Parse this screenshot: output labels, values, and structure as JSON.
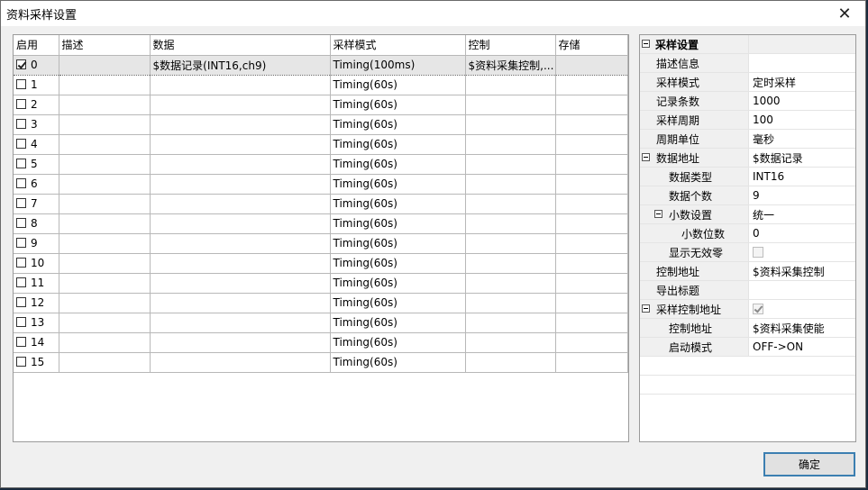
{
  "window": {
    "title": "资料采样设置",
    "close_label": "✕"
  },
  "grid": {
    "columns": [
      "启用",
      "描述",
      "数据",
      "采样模式",
      "控制",
      "存储"
    ],
    "rows": [
      {
        "enabled": true,
        "index": "0",
        "desc": "",
        "data": "$数据记录(INT16,ch9)",
        "mode": "Timing(100ms)",
        "control": "$资料采集控制,...",
        "storage": ""
      },
      {
        "enabled": false,
        "index": "1",
        "desc": "",
        "data": "",
        "mode": "Timing(60s)",
        "control": "",
        "storage": ""
      },
      {
        "enabled": false,
        "index": "2",
        "desc": "",
        "data": "",
        "mode": "Timing(60s)",
        "control": "",
        "storage": ""
      },
      {
        "enabled": false,
        "index": "3",
        "desc": "",
        "data": "",
        "mode": "Timing(60s)",
        "control": "",
        "storage": ""
      },
      {
        "enabled": false,
        "index": "4",
        "desc": "",
        "data": "",
        "mode": "Timing(60s)",
        "control": "",
        "storage": ""
      },
      {
        "enabled": false,
        "index": "5",
        "desc": "",
        "data": "",
        "mode": "Timing(60s)",
        "control": "",
        "storage": ""
      },
      {
        "enabled": false,
        "index": "6",
        "desc": "",
        "data": "",
        "mode": "Timing(60s)",
        "control": "",
        "storage": ""
      },
      {
        "enabled": false,
        "index": "7",
        "desc": "",
        "data": "",
        "mode": "Timing(60s)",
        "control": "",
        "storage": ""
      },
      {
        "enabled": false,
        "index": "8",
        "desc": "",
        "data": "",
        "mode": "Timing(60s)",
        "control": "",
        "storage": ""
      },
      {
        "enabled": false,
        "index": "9",
        "desc": "",
        "data": "",
        "mode": "Timing(60s)",
        "control": "",
        "storage": ""
      },
      {
        "enabled": false,
        "index": "10",
        "desc": "",
        "data": "",
        "mode": "Timing(60s)",
        "control": "",
        "storage": ""
      },
      {
        "enabled": false,
        "index": "11",
        "desc": "",
        "data": "",
        "mode": "Timing(60s)",
        "control": "",
        "storage": ""
      },
      {
        "enabled": false,
        "index": "12",
        "desc": "",
        "data": "",
        "mode": "Timing(60s)",
        "control": "",
        "storage": ""
      },
      {
        "enabled": false,
        "index": "13",
        "desc": "",
        "data": "",
        "mode": "Timing(60s)",
        "control": "",
        "storage": ""
      },
      {
        "enabled": false,
        "index": "14",
        "desc": "",
        "data": "",
        "mode": "Timing(60s)",
        "control": "",
        "storage": ""
      },
      {
        "enabled": false,
        "index": "15",
        "desc": "",
        "data": "",
        "mode": "Timing(60s)",
        "control": "",
        "storage": ""
      }
    ]
  },
  "properties": [
    {
      "name": "采样设置",
      "value": "",
      "level": 0,
      "category": true,
      "expander": true
    },
    {
      "name": "描述信息",
      "value": "",
      "level": 1
    },
    {
      "name": "采样模式",
      "value": "定时采样",
      "level": 1
    },
    {
      "name": "记录条数",
      "value": "1000",
      "level": 1
    },
    {
      "name": "采样周期",
      "value": "100",
      "level": 1
    },
    {
      "name": "周期单位",
      "value": "毫秒",
      "level": 1
    },
    {
      "name": "数据地址",
      "value": "$数据记录",
      "level": 1,
      "expander": true
    },
    {
      "name": "数据类型",
      "value": "INT16",
      "level": 2
    },
    {
      "name": "数据个数",
      "value": "9",
      "level": 2
    },
    {
      "name": "小数设置",
      "value": "统一",
      "level": 2,
      "expander": true
    },
    {
      "name": "小数位数",
      "value": "0",
      "level": 3
    },
    {
      "name": "显示无效零",
      "value": "",
      "level": 2,
      "checkbox": false
    },
    {
      "name": "控制地址",
      "value": "$资料采集控制",
      "level": 1
    },
    {
      "name": "导出标题",
      "value": "",
      "level": 1
    },
    {
      "name": "采样控制地址",
      "value": "",
      "level": 1,
      "expander": true,
      "checkbox": true
    },
    {
      "name": "控制地址",
      "value": "$资料采集使能",
      "level": 2
    },
    {
      "name": "启动模式",
      "value": "OFF->ON",
      "level": 2
    }
  ],
  "footer": {
    "ok_label": "确定"
  }
}
